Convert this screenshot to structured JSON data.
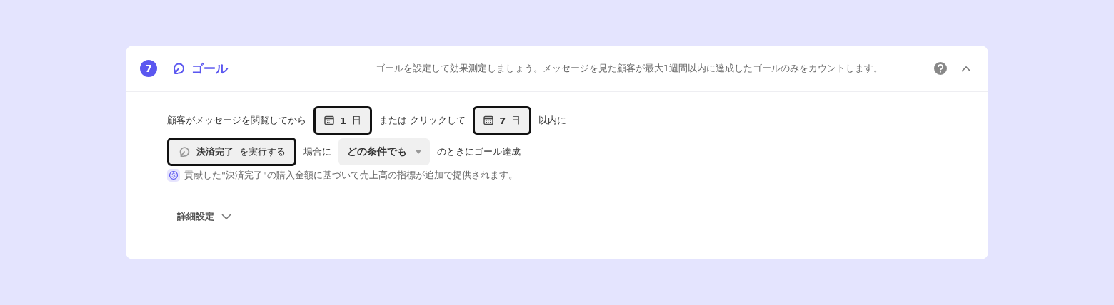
{
  "header": {
    "step": "7",
    "title": "ゴール",
    "description": "ゴールを設定して効果測定しましょう。メッセージを見た顧客が最大1週間以内に達成したゴールのみをカウントします。",
    "expanded": true
  },
  "sentence": [
    {
      "kind": "text",
      "text": "顧客がメッセージを閲覧してから"
    },
    {
      "kind": "date",
      "value": "1",
      "unit": "日",
      "highlighted": true
    },
    {
      "kind": "text",
      "text": "または クリックして"
    },
    {
      "kind": "date",
      "value": "7",
      "unit": "日",
      "highlighted": true
    },
    {
      "kind": "text",
      "text": "以内に"
    },
    {
      "kind": "break"
    },
    {
      "kind": "event",
      "name": "決済完了",
      "suffix": "を実行する",
      "highlighted": true
    },
    {
      "kind": "text",
      "text": "場合に"
    },
    {
      "kind": "select",
      "value": "どの条件でも"
    },
    {
      "kind": "text",
      "text": "のときにゴール達成"
    }
  ],
  "note": "貢献した\"決済完了\"の購入金額に基づいて売上高の指標が追加で提供されます。",
  "advanced": {
    "label": "詳細設定",
    "expanded": false
  }
}
